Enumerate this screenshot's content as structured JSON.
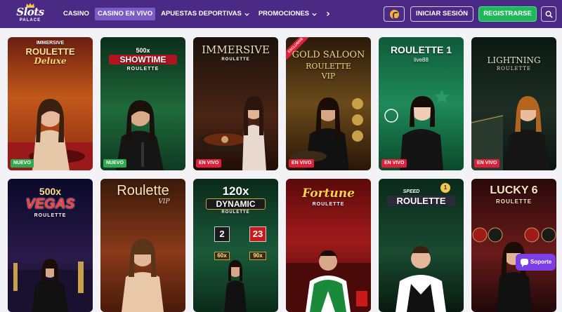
{
  "header": {
    "logo_text": "Slots",
    "logo_sub": "PALACE",
    "nav": [
      {
        "label": "CASINO",
        "active": false,
        "dropdown": false
      },
      {
        "label": "CASINO EN VIVO",
        "active": true,
        "dropdown": false
      },
      {
        "label": "APUESTAS DEPORTIVAS",
        "active": false,
        "dropdown": true
      },
      {
        "label": "PROMOCIONES",
        "active": false,
        "dropdown": true
      }
    ],
    "nav_more_icon": "chevron-right-icon",
    "coin_icon": "coin-icon",
    "login_label": "INICIAR SESIÓN",
    "register_label": "REGISTRARSE",
    "search_icon": "search-icon",
    "colors": {
      "header_bg": "#4a2a85",
      "active_nav": "#7b5bc4",
      "register": "#1fb75a"
    }
  },
  "games": [
    {
      "title_lines": [
        "IMMERSIVE",
        "ROULETTE",
        "Deluxe"
      ],
      "badge": "NUEVO",
      "badge_type": "new",
      "bg": [
        "#7a2a14",
        "#c9661f"
      ]
    },
    {
      "title_lines": [
        "500x",
        "SHOWTIME",
        "ROULETTE"
      ],
      "badge": "NUEVO",
      "badge_type": "new",
      "bg": [
        "#0f3a22",
        "#1f6a3a"
      ]
    },
    {
      "title_lines": [
        "IMMERSIVE",
        "ROULETTE"
      ],
      "badge": "EN VIVO",
      "badge_type": "live",
      "bg": [
        "#1a0f0a",
        "#5a2a1a"
      ]
    },
    {
      "title_lines": [
        "GOLD SALOON",
        "ROULETTE",
        "VIP"
      ],
      "badge": "EN VIVO",
      "badge_type": "live",
      "ribbon": "EXCLUSIVE",
      "bg": [
        "#2a1a0a",
        "#6a4a1a"
      ]
    },
    {
      "title_lines": [
        "ROULETTE 1",
        "live88"
      ],
      "badge": "EN VIVO",
      "badge_type": "live",
      "bg": [
        "#0f5a3a",
        "#1f8a5a"
      ]
    },
    {
      "title_lines": [
        "LIGHTNING",
        "ROULETTE"
      ],
      "badge": "EN VIVO",
      "badge_type": "live",
      "bg": [
        "#0a1a12",
        "#2a3a2a"
      ]
    },
    {
      "title_lines": [
        "500x",
        "VEGAS",
        "ROULETTE"
      ],
      "badge": "",
      "badge_type": "",
      "bg": [
        "#0a0a2a",
        "#2a1a4a"
      ]
    },
    {
      "title_lines": [
        "Roulette",
        "VIP"
      ],
      "badge": "",
      "badge_type": "",
      "bg": [
        "#3a1a0a",
        "#8a3a1a"
      ]
    },
    {
      "title_lines": [
        "120x",
        "DYNAMIC",
        "ROULETTE"
      ],
      "badge": "",
      "badge_type": "",
      "bg": [
        "#0a2a1a",
        "#1a5a3a"
      ]
    },
    {
      "title_lines": [
        "Fortune",
        "ROULETTE"
      ],
      "badge": "",
      "badge_type": "",
      "bg": [
        "#5a0a0a",
        "#a01a1a"
      ]
    },
    {
      "title_lines": [
        "SPEED",
        "ROULETTE",
        "1"
      ],
      "badge": "",
      "badge_type": "",
      "bg": [
        "#0a2a1a",
        "#1a4a30"
      ]
    },
    {
      "title_lines": [
        "LUCKY 6",
        "ROULETTE"
      ],
      "badge": "",
      "badge_type": "",
      "bg": [
        "#2a0a0a",
        "#6a1a1a"
      ]
    }
  ],
  "dynamic_numbers": [
    "2",
    "23",
    "60x",
    "90x"
  ],
  "support": {
    "label": "Soporte",
    "icon": "chat-bubble-icon"
  }
}
